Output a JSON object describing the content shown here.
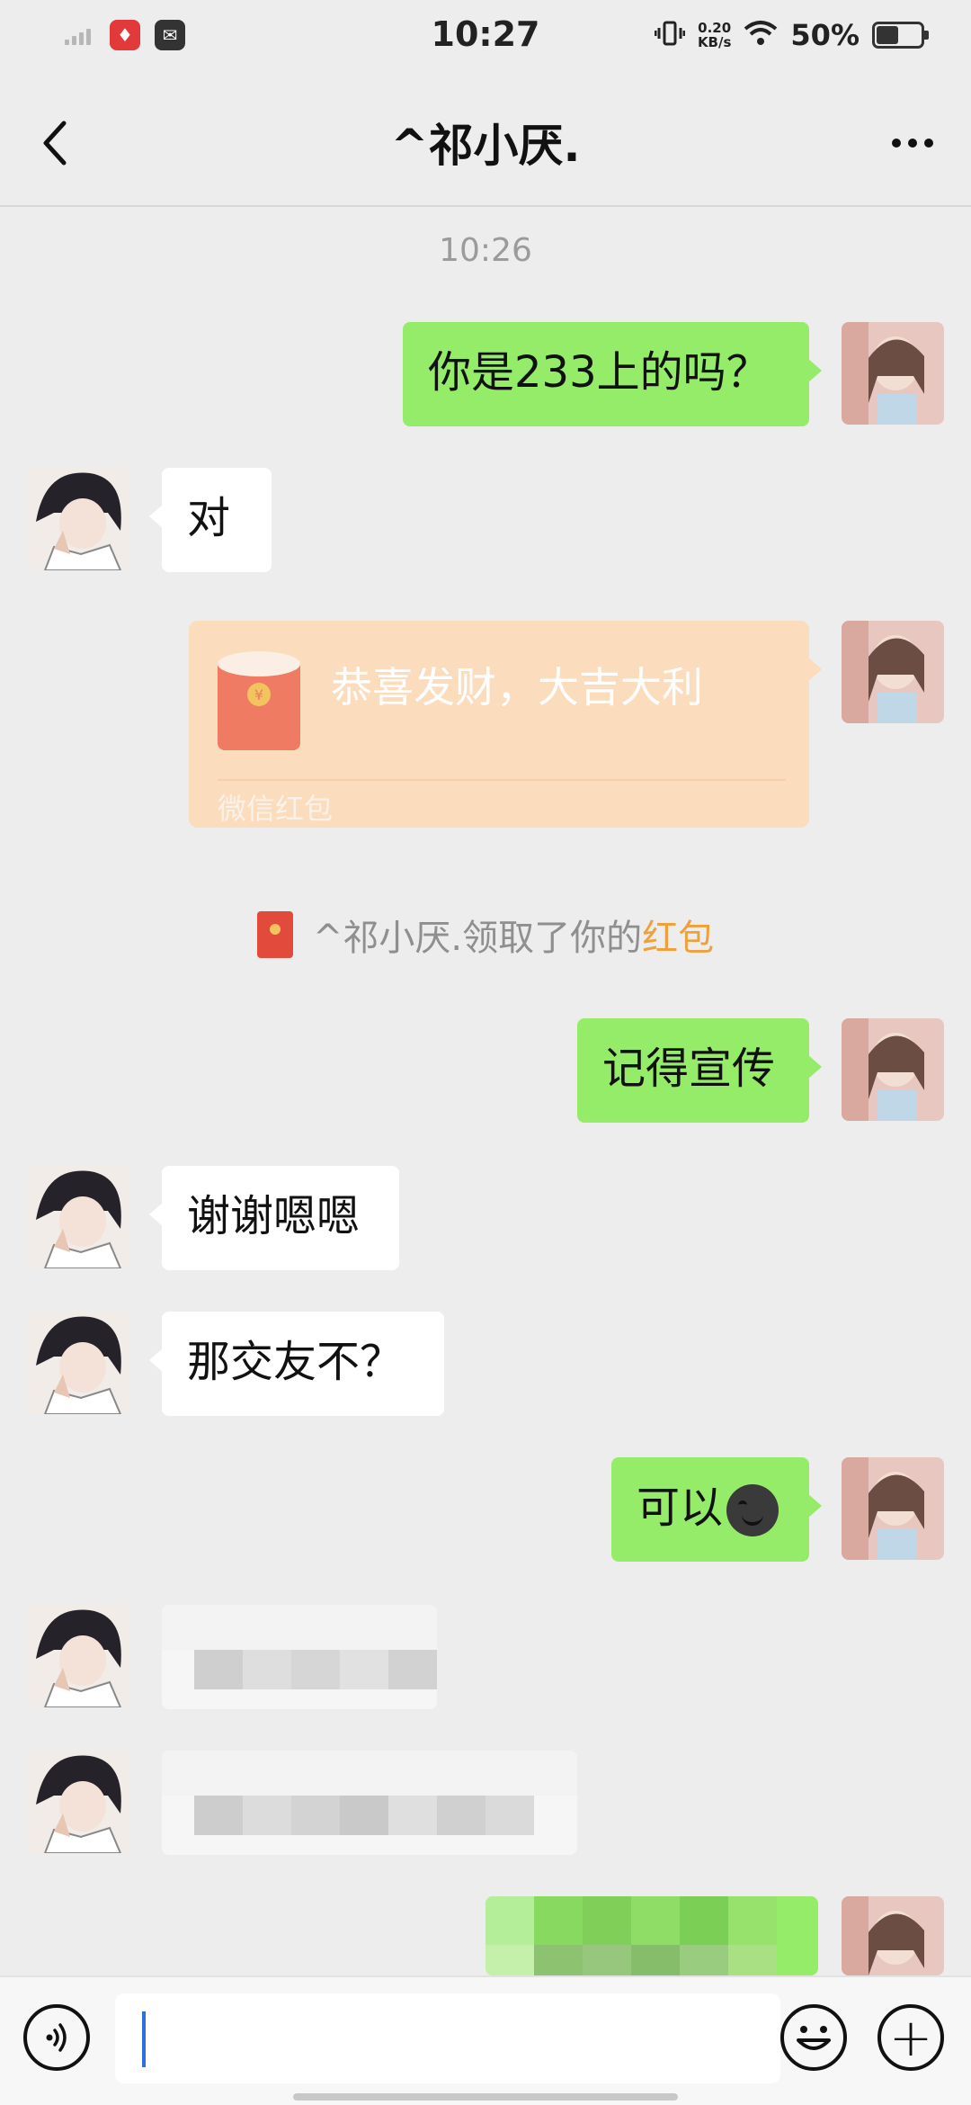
{
  "status_bar": {
    "time": "10:27",
    "net_speed_value": "0.20",
    "net_speed_unit": "KB/s",
    "battery_percent": "50%",
    "battery_level": 0.5,
    "icons": [
      "signal-icon",
      "app-notification-icon",
      "message-notification-icon",
      "vibrate-icon",
      "wifi-icon",
      "battery-icon"
    ]
  },
  "header": {
    "title": "^祁小厌.",
    "back_icon": "chevron-left-icon",
    "more_icon": "more-dots-icon"
  },
  "chat": {
    "timestamp": "10:26",
    "messages": [
      {
        "side": "right",
        "type": "text",
        "text": "你是233上的吗？"
      },
      {
        "side": "left",
        "type": "text",
        "text": "对"
      },
      {
        "side": "right",
        "type": "red_packet",
        "greeting": "恭喜发财，大吉大利",
        "label": "微信红包"
      },
      {
        "type": "system",
        "text": "^祁小厌.领取了你的",
        "highlight": "红包"
      },
      {
        "side": "right",
        "type": "text",
        "text": "记得宣传"
      },
      {
        "side": "left",
        "type": "text",
        "text": "谢谢嗯嗯"
      },
      {
        "side": "left",
        "type": "text",
        "text": "那交友不？"
      },
      {
        "side": "right",
        "type": "text",
        "text": "可以",
        "emoji": "smirk-emoji-icon"
      },
      {
        "side": "left",
        "type": "blurred"
      },
      {
        "side": "left",
        "type": "blurred"
      },
      {
        "side": "right",
        "type": "blurred"
      }
    ]
  },
  "input_bar": {
    "voice_icon": "voice-icon",
    "emoji_icon": "emoji-icon",
    "plus_icon": "plus-icon",
    "input_value": "",
    "plus_glyph": "+"
  },
  "colors": {
    "background": "#ededed",
    "sent_bubble": "#95ec69",
    "received_bubble": "#ffffff",
    "red_packet": "#fbdcbc",
    "highlight": "#f0a03a"
  }
}
